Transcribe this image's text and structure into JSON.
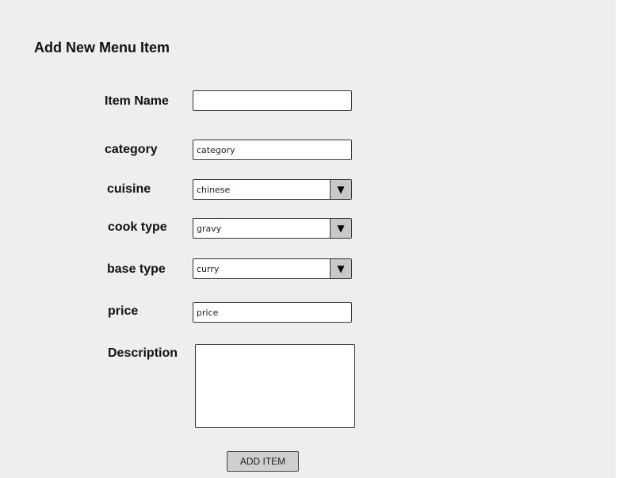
{
  "title": "Add New Menu Item",
  "form": {
    "item_name": {
      "label": "Item Name",
      "value": ""
    },
    "category": {
      "label": "category",
      "placeholder": "category"
    },
    "cuisine": {
      "label": "cuisine",
      "value": "chinese"
    },
    "cook_type": {
      "label": "cook type",
      "value": "gravy"
    },
    "base_type": {
      "label": "base type",
      "value": "curry"
    },
    "price": {
      "label": "price",
      "placeholder": "price"
    },
    "description": {
      "label": "Description",
      "value": ""
    },
    "submit_label": "ADD ITEM",
    "dropdown_icon": "triangle-down-icon"
  }
}
